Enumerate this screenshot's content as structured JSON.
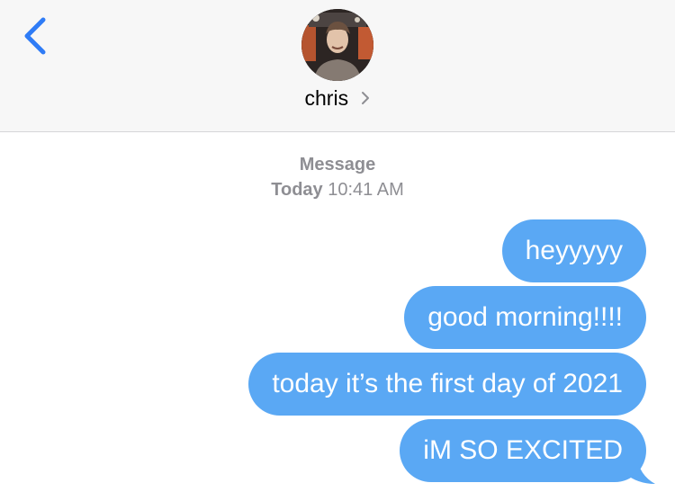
{
  "header": {
    "back_icon": "chevron-left-icon",
    "contact_name": "chris",
    "chevron_icon": "chevron-right-icon",
    "avatar": "contact-photo"
  },
  "conversation": {
    "service_label": "Message",
    "day_label": "Today",
    "time_label": "10:41 AM",
    "messages": [
      "heyyyyy",
      "good morning!!!!",
      "today it’s the first day of 2021",
      "iM SO EXCITED"
    ]
  },
  "colors": {
    "bubble": "#5aa8f4",
    "accent": "#2f7cf6",
    "header_bg": "#f7f7f7",
    "meta_text": "#8e8e93"
  }
}
